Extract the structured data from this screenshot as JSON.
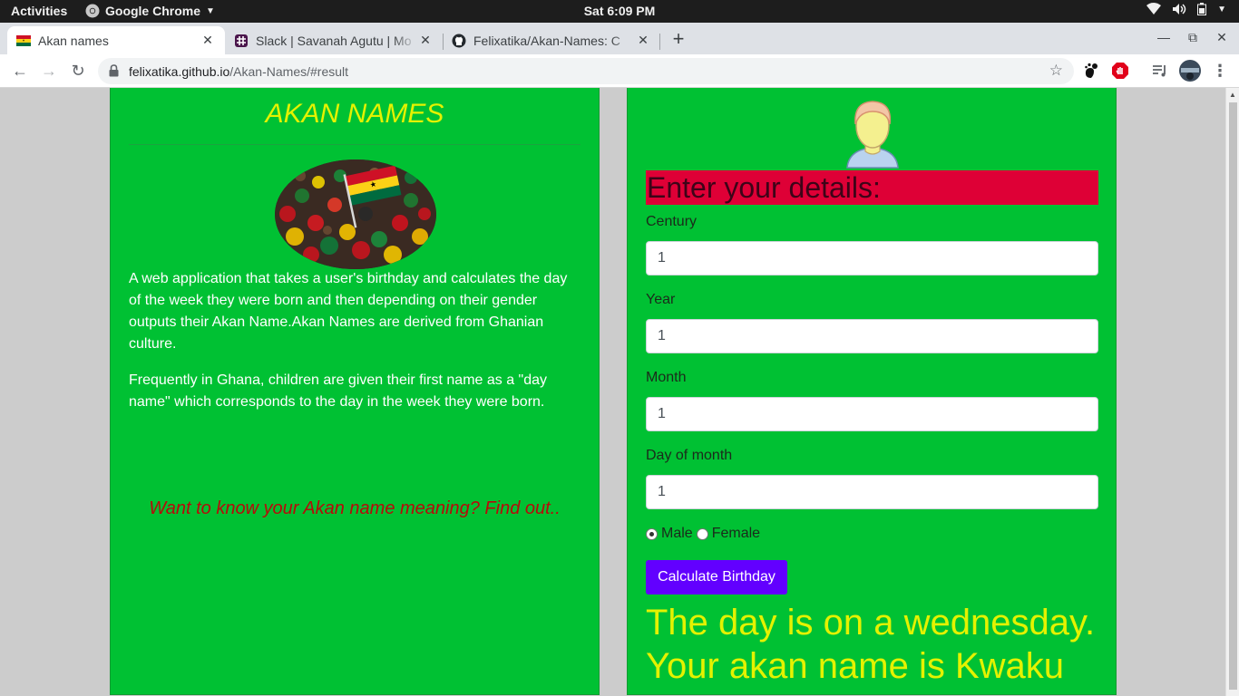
{
  "system_bar": {
    "activities": "Activities",
    "app_name": "Google Chrome",
    "clock": "Sat  6:09 PM"
  },
  "browser": {
    "tabs": [
      {
        "title": "Akan names",
        "active": true
      },
      {
        "title": "Slack | Savanah Agutu | Mo",
        "active": false
      },
      {
        "title": "Felixatika/Akan-Names: C",
        "active": false
      }
    ],
    "url_host": "felixatika.github.io",
    "url_path": "/Akan-Names/#result"
  },
  "left": {
    "title": "AKAN NAMES",
    "description_1": "A web application that takes a user's birthday and calculates the day of the week they were born and then depending on their gender outputs their Akan Name.Akan Names are derived from Ghanian culture.",
    "description_2": "Frequently in Ghana, children are given their first name as a \"day name\" which corresponds to the day in the week they were born.",
    "cta": "Want to know your Akan name meaning? Find out.."
  },
  "form": {
    "heading": "Enter your details:",
    "century_label": "Century",
    "century_value": "1",
    "year_label": "Year",
    "year_value": "1",
    "month_label": "Month",
    "month_value": "1",
    "day_label": "Day of month",
    "day_value": "1",
    "male_label": "Male",
    "female_label": "Female",
    "selected_gender": "Male",
    "submit_label": "Calculate Birthday"
  },
  "result": {
    "line1": "The day is on a wednesday.",
    "line2": "Your akan name is Kwaku"
  },
  "colors": {
    "panel_green": "#00c133",
    "title_yellow": "#e4f200",
    "heading_red": "#de0036",
    "button_purple": "#6200ff",
    "cta_red": "#b80a0a"
  }
}
